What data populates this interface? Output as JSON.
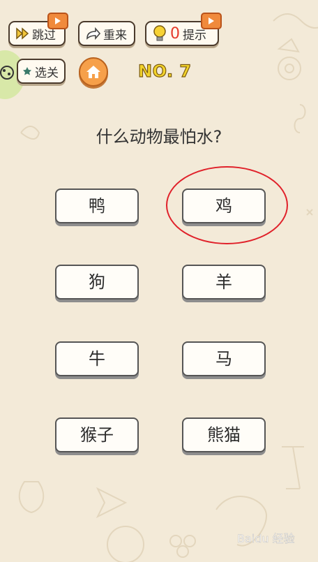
{
  "toolbar": {
    "skip_label": "跳过",
    "restart_label": "重来",
    "hint_count": "0",
    "hint_label": "提示",
    "level_select_label": "选关",
    "level_number": "NO. 7"
  },
  "question": "什么动物最怕水?",
  "answers": [
    "鸭",
    "鸡",
    "狗",
    "羊",
    "牛",
    "马",
    "猴子",
    "熊猫"
  ],
  "highlighted_answer": "鸡",
  "watermark": "Baidu 经验",
  "colors": {
    "accent_orange": "#f6a04a",
    "level_yellow": "#f2d32b",
    "circle_red": "#e0212a",
    "background": "#f3ead8"
  },
  "icons": {
    "skip": "fast-forward-icon",
    "restart": "redo-arrow-icon",
    "hint": "lightbulb-icon",
    "home": "home-icon",
    "video": "video-ad-icon"
  }
}
